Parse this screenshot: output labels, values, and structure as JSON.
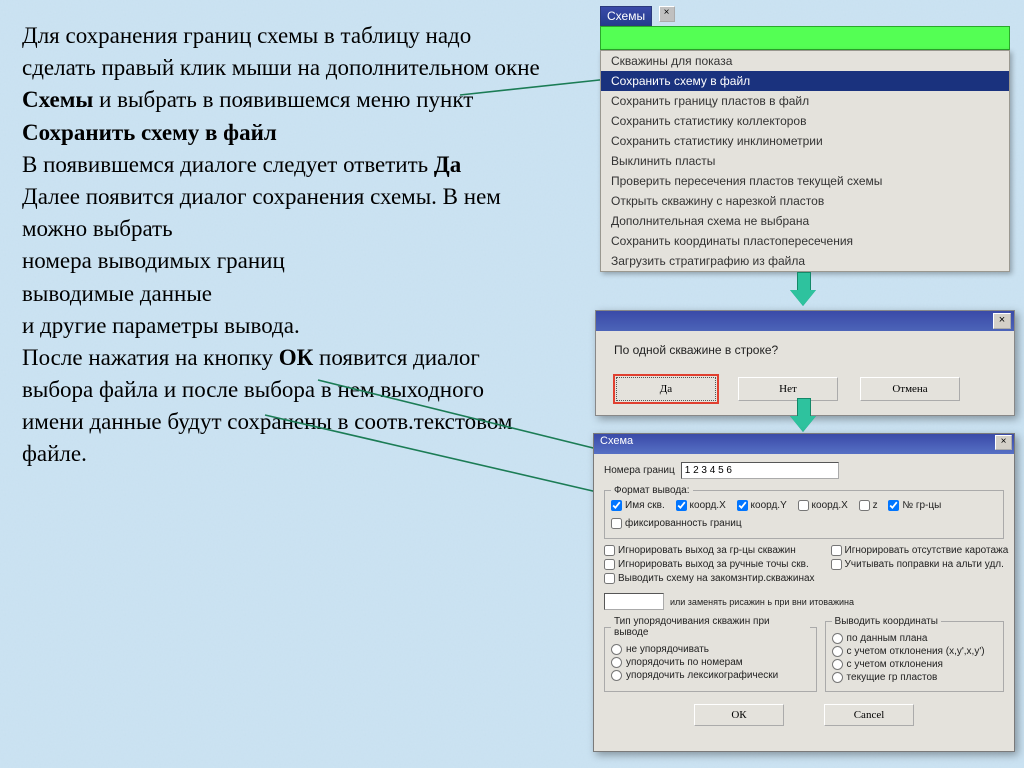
{
  "instruction": {
    "t1": "Для сохранения границ схемы в таблицу надо сделать правый клик мыши на дополнительном окне ",
    "b1": "Схемы",
    "t2": " и выбрать в появившемся меню пункт ",
    "b2": "Сохранить схему в файл",
    "t3": "В появившемся диалоге следует ответить ",
    "b3": "Да",
    "t4": "Далее появится диалог сохранения схемы. В нем можно выбрать",
    "t5": "номера выводимых границ",
    "t6": "выводимые данные",
    "t7": "и другие параметры вывода.",
    "t8": "После нажатия на кнопку ",
    "b4": "ОК",
    "t9": " появится диалог выбора файла и после выбора в нем выходного имени данные будут сохранены в соотв.текстовом файле."
  },
  "panel1": {
    "title": "Схемы",
    "items": [
      "Скважины для показа",
      "Сохранить схему в файл",
      "Сохранить границу пластов в файл",
      "Сохранить статистику коллекторов",
      "Сохранить статистику инклинометрии",
      "Выклинить пласты",
      "Проверить пересечения пластов текущей схемы",
      "Открыть скважину с нарезкой пластов",
      "Дополнительная схема не выбрана",
      "Сохранить координаты пластопересечения",
      "Загрузить стратиграфию из файла"
    ],
    "selected": 1
  },
  "panel2": {
    "msg": "По одной скважине в строке?",
    "yes": "Да",
    "no": "Нет",
    "cancel": "Отмена",
    "close_x": "×"
  },
  "panel3": {
    "title": "Схема",
    "label_numbers": "Номера границ",
    "value_numbers": "1 2 3 4 5 6",
    "group_format": "Формат вывода:",
    "cb_namesk": "Имя скв.",
    "cb_kx": "коорд.X",
    "cb_ky": "коорд.Y",
    "cb_kx2": "коорд.X",
    "cb_z": "z",
    "cb_grcy": "№ гр-цы",
    "cb_fixbound": "фиксированность границ",
    "cb_ign_out_wells": "Игнорировать выход за гр-цы скважин",
    "cb_ign_out_hand": "Игнорировать выход за ручные точы скв.",
    "cb_out_closed": "Выводить схему на закомзнтир.скважинах",
    "cb_ign_nolog": "Игнорировать отсутствие каротажа",
    "cb_corr_alt": "Учитывать поправки на альти удл.",
    "label_or": "или заменять рисажин ь при вни итоважина",
    "group_sort": "Тип упорядочивания скважин при выводе",
    "r_sort_none": "не упорядочивать",
    "r_sort_num": "упорядочить по номерам",
    "r_sort_lex": "упорядочить лексикографически",
    "group_coord": "Выводить координаты",
    "r_crd_plan": "по данным плана",
    "r_crd_incl": "с учетом отклонения (x,y',x,y')",
    "r_crd_incl2": "с учетом отклонения",
    "r_crd_cur": "текущие гр пластов",
    "ok": "ОК",
    "cancel": "Cancel",
    "close_x": "×"
  }
}
